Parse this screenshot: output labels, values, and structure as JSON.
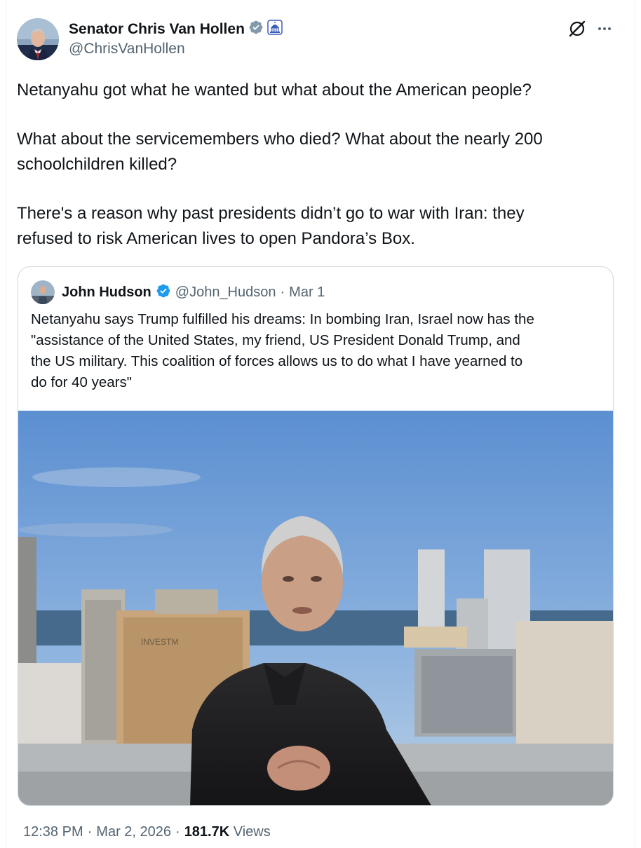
{
  "author": {
    "name": "Senator Chris Van Hollen",
    "handle": "@ChrisVanHollen",
    "verified_icon": "verified-badge-icon",
    "affiliation_icon": "capitol-icon"
  },
  "header_actions": {
    "grok_icon": "grok-icon",
    "more_icon": "more-icon"
  },
  "tweet": {
    "paragraphs": [
      [
        "Netanyahu got what he wanted but what about the American people?"
      ],
      [
        "What about the servicemembers who died? What about the nearly 200",
        "schoolchildren killed?"
      ],
      [
        "There's a reason why past presidents didn’t go to war with Iran: they",
        "refused to risk American lives to open Pandora’s Box."
      ]
    ]
  },
  "quote": {
    "name": "John Hudson",
    "handle": "@John_Hudson",
    "separator": "·",
    "date": "Mar 1",
    "lines": [
      "Netanyahu says Trump fulfilled his dreams: In bombing Iran, Israel now has the",
      "\"assistance of the United States, my friend, US President Donald Trump, and",
      "the US military. This coalition of forces allows us to do what I have yearned to",
      "do for 40 years\""
    ],
    "image_sign_text": "INVESTM"
  },
  "meta": {
    "time": "12:38 PM",
    "sep1": "·",
    "date": "Mar 2, 2026",
    "sep2": "·",
    "views_count": "181.7K",
    "views_label": "Views"
  },
  "colors": {
    "text": "#0f1419",
    "secondary": "#536471",
    "verified": "#829aab",
    "quote_verified": "#1d9bf0",
    "border": "#cfd9de"
  }
}
